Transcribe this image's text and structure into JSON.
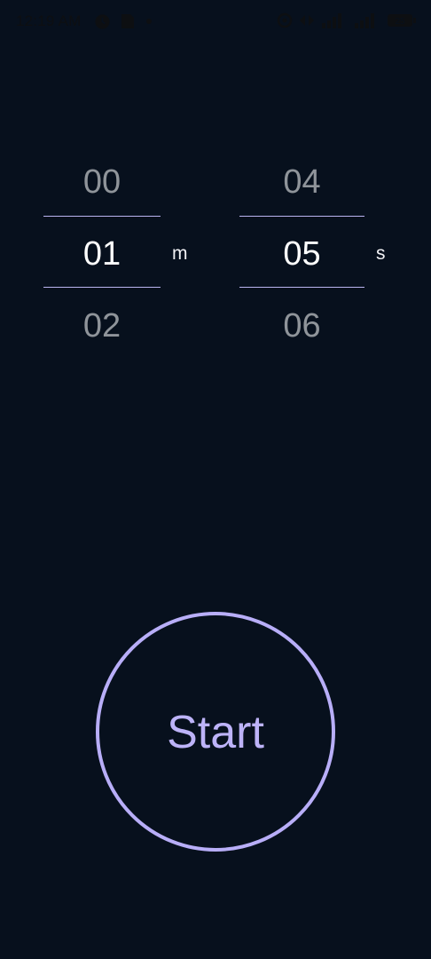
{
  "status_bar": {
    "time": "12:19 AM",
    "battery": "25"
  },
  "picker": {
    "minutes": {
      "prev": "00",
      "selected": "01",
      "next": "02",
      "unit": "m"
    },
    "seconds": {
      "prev": "04",
      "selected": "05",
      "next": "06",
      "unit": "s"
    }
  },
  "start_button": {
    "label": "Start"
  },
  "colors": {
    "background": "#07101d",
    "accent": "#b8aef8",
    "divider": "#b9b4f0",
    "dim_text": "#8f949a",
    "selected_text": "#ffffff"
  },
  "icons": {
    "status_left": [
      "alarm-icon",
      "sim-card-icon",
      "dot-icon"
    ],
    "status_right": [
      "wifi-calling-icon",
      "data-arrows-icon",
      "signal-icon",
      "signal-icon-2",
      "battery-icon"
    ]
  }
}
